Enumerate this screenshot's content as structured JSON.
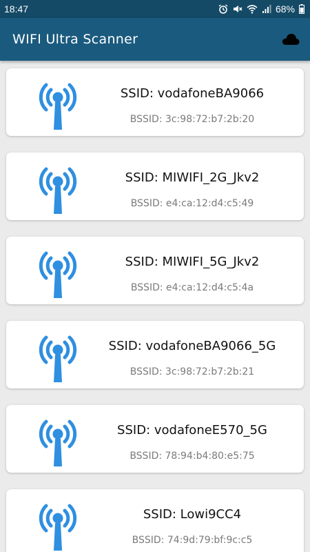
{
  "status_bar": {
    "time": "18:47",
    "battery": "68%",
    "icons": [
      "alarm-icon",
      "mute-icon",
      "wifi-signal-icon",
      "cell-signal-icon",
      "battery-icon"
    ]
  },
  "app_bar": {
    "title": "WIFI Ultra Scanner",
    "action_icon": "cloud-icon"
  },
  "colors": {
    "status_bar": "#154a66",
    "app_bar": "#1a5a7e",
    "wifi_icon": "#2f8fe0",
    "background": "#ebebeb"
  },
  "networks": [
    {
      "ssid": "SSID: vodafoneBA9066",
      "bssid": "BSSID: 3c:98:72:b7:2b:20",
      "icon": "wifi-antenna-icon"
    },
    {
      "ssid": "SSID: MIWIFI_2G_Jkv2",
      "bssid": "BSSID: e4:ca:12:d4:c5:49",
      "icon": "wifi-antenna-icon"
    },
    {
      "ssid": "SSID: MIWIFI_5G_Jkv2",
      "bssid": "BSSID: e4:ca:12:d4:c5:4a",
      "icon": "wifi-antenna-icon"
    },
    {
      "ssid": "SSID: vodafoneBA9066_5G",
      "bssid": "BSSID: 3c:98:72:b7:2b:21",
      "icon": "wifi-antenna-icon"
    },
    {
      "ssid": "SSID: vodafoneE570_5G",
      "bssid": "BSSID: 78:94:b4:80:e5:75",
      "icon": "wifi-antenna-icon"
    },
    {
      "ssid": "SSID: Lowi9CC4",
      "bssid": "BSSID: 74:9d:79:bf:9c:c5",
      "icon": "wifi-antenna-icon"
    }
  ]
}
